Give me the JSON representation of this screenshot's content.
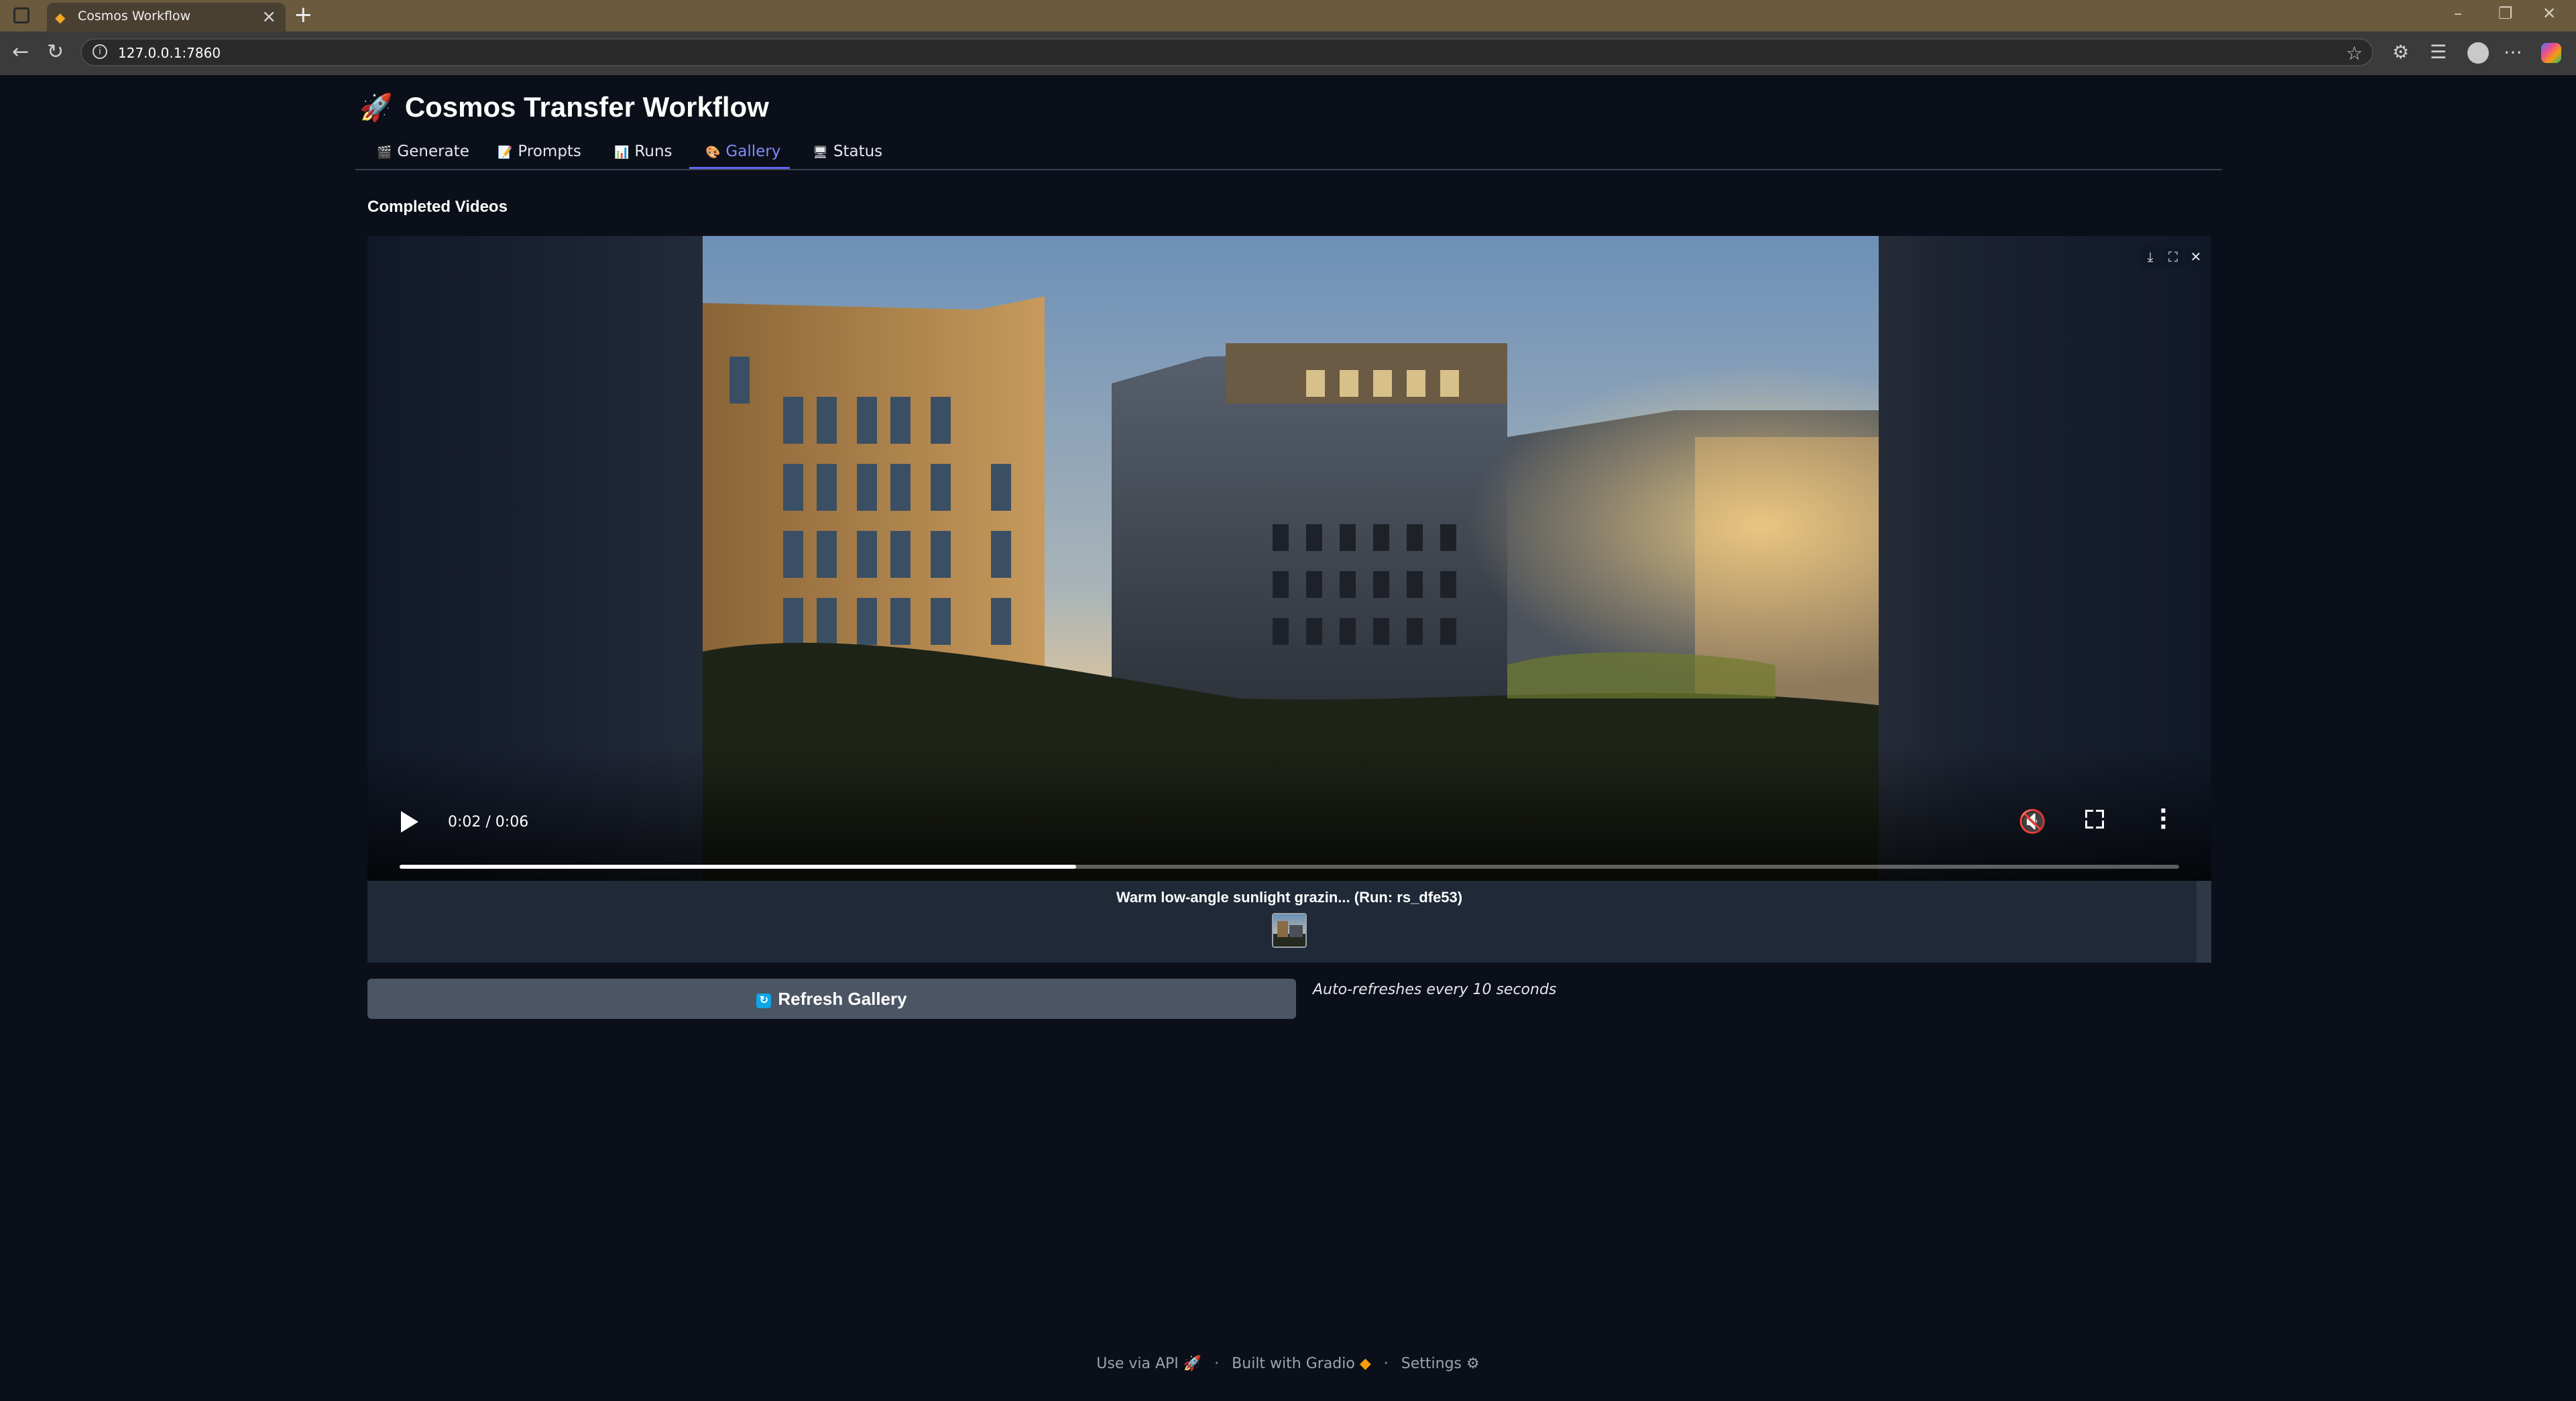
{
  "browser": {
    "tab_title": "Cosmos Workflow",
    "url": "127.0.0.1:7860"
  },
  "app": {
    "title": "Cosmos Transfer Workflow",
    "tabs": [
      {
        "label": "Generate",
        "icon": "🎬"
      },
      {
        "label": "Prompts",
        "icon": "📝"
      },
      {
        "label": "Runs",
        "icon": "📊"
      },
      {
        "label": "Gallery",
        "icon": "🎨",
        "selected": true
      },
      {
        "label": "Status",
        "icon": "🖥"
      }
    ]
  },
  "gallery": {
    "label": "Completed Videos",
    "video": {
      "current_time": "0:02 / 0:06",
      "progress": 0.38
    },
    "caption": "Warm low-angle sunlight grazin... (Run: rs_dfe53)"
  },
  "refresh": {
    "label": "Refresh Gallery",
    "note": "Auto-refreshes every 10 seconds"
  },
  "footer": {
    "api": "Use via API",
    "built": "Built with Gradio",
    "settings": "Settings"
  },
  "colors": {
    "accent": "#6366f1",
    "background": "#0b0f19",
    "button": "#4b5563"
  }
}
